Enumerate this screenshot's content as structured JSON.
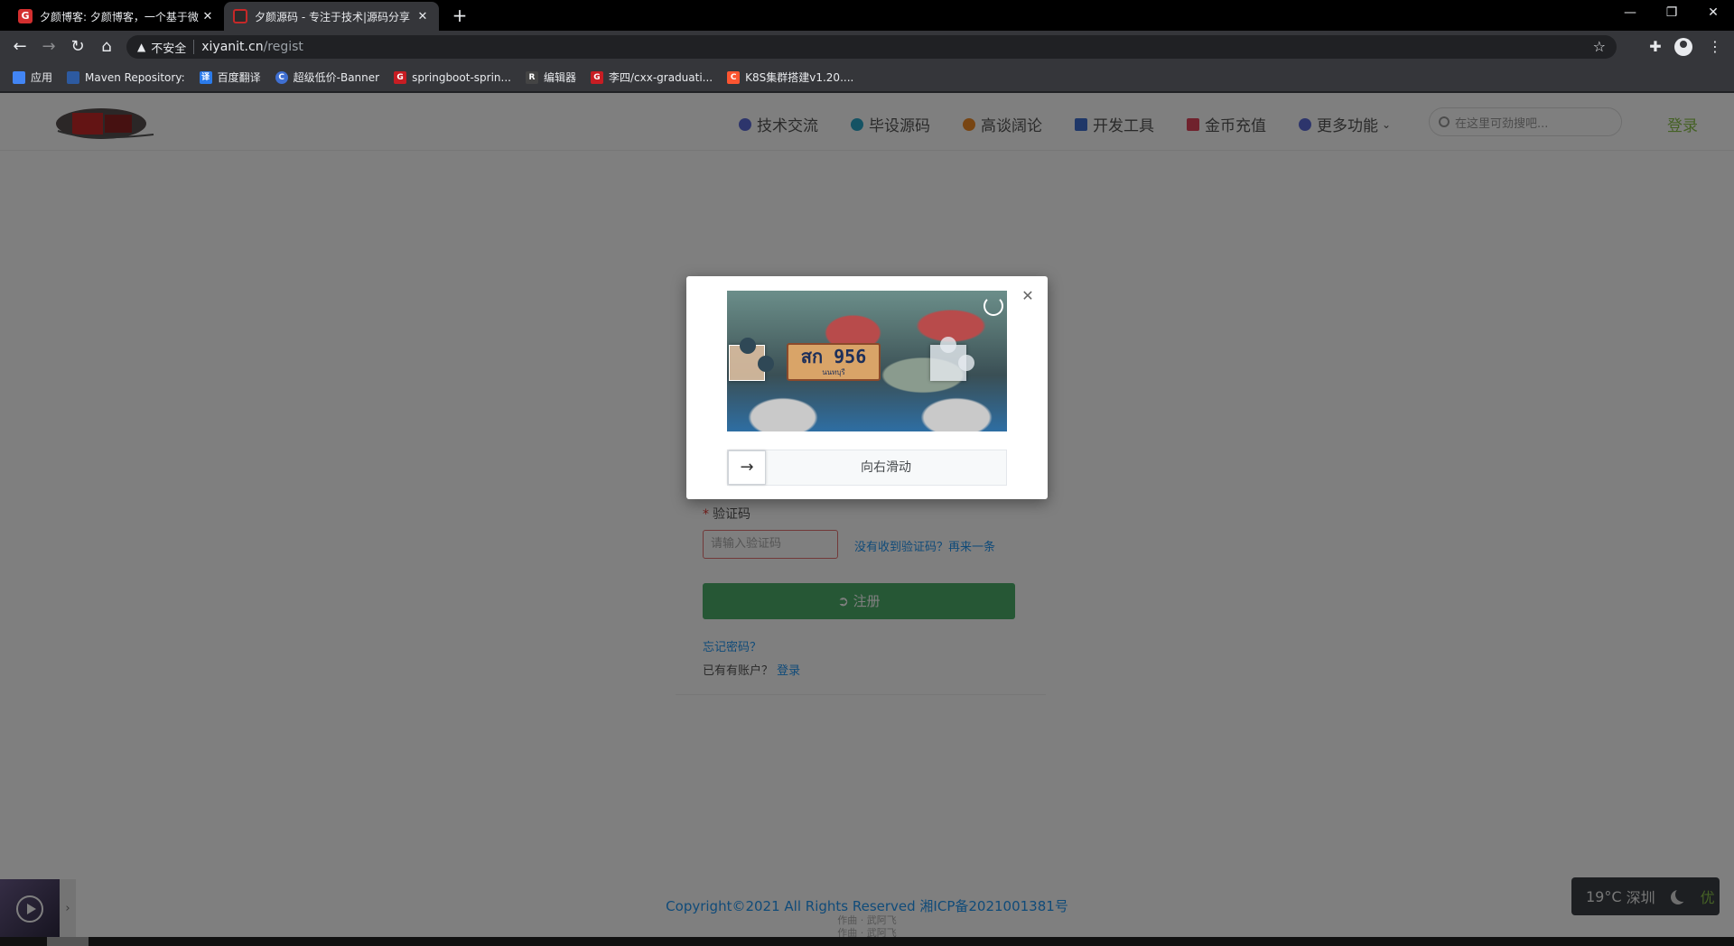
{
  "browser": {
    "tabs": [
      {
        "title": "夕颜博客: 夕颜博客，一个基于微",
        "close": "✕"
      },
      {
        "title": "夕颜源码 - 专注于技术|源码分享",
        "close": "✕"
      }
    ],
    "new_tab": "+",
    "window_controls": {
      "minimize": "—",
      "restore": "❐",
      "close": "✕"
    },
    "nav": {
      "back": "←",
      "forward": "→",
      "reload": "↻",
      "home": "⌂"
    },
    "address": {
      "security_label": "不安全",
      "host": "xiyanit.cn",
      "path": "/regist"
    },
    "bookmarks": [
      {
        "label": "应用",
        "icon": "apps-grid-icon",
        "color": "#4285f4"
      },
      {
        "label": "Maven Repository:",
        "icon": "maven-icon",
        "color": "#2d5aa0"
      },
      {
        "label": "百度翻译",
        "icon": "baidu-translate-icon",
        "color": "#2b7bea"
      },
      {
        "label": "超级低价-Banner",
        "icon": "c-logo-icon",
        "color": "#3f6fd1"
      },
      {
        "label": "springboot-sprin...",
        "icon": "gitee-icon",
        "color": "#c71d23"
      },
      {
        "label": "编辑器",
        "icon": "editor-icon",
        "color": "#444444"
      },
      {
        "label": "李四/cxx-graduati...",
        "icon": "gitee-icon",
        "color": "#c71d23"
      },
      {
        "label": "K8S集群搭建v1.20....",
        "icon": "csdn-icon",
        "color": "#fc5531"
      }
    ]
  },
  "site": {
    "nav": [
      {
        "label": "技术交流",
        "icon": "rocket-icon",
        "color": "#5b6bd8"
      },
      {
        "label": "毕设源码",
        "icon": "nodes-icon",
        "color": "#2aa6c9"
      },
      {
        "label": "高谈阔论",
        "icon": "cloud-icon",
        "color": "#f08a24"
      },
      {
        "label": "开发工具",
        "icon": "briefcase-icon",
        "color": "#3f6fd1"
      },
      {
        "label": "金币充值",
        "icon": "card-icon",
        "color": "#e0445a"
      },
      {
        "label": "更多功能",
        "icon": "more-icon",
        "color": "#5b6bd8"
      }
    ],
    "search_placeholder": "在这里可劲搜吧...",
    "login": "登录"
  },
  "form": {
    "code_label": "验证码",
    "code_placeholder": "请输入验证码",
    "resend": "没有收到验证码？再来一条",
    "submit": "注册",
    "forgot": "忘记密码？",
    "have_account": "已有有账户？",
    "login_link": "登录"
  },
  "captcha": {
    "plate_number": "สก 956",
    "plate_sub": "นนทบุรี",
    "slide_hint": "向右滑动",
    "handle_arrow": "→",
    "close": "✕"
  },
  "footer": {
    "copyright": "Copyright©2021 All Rights Reserved 湘ICP备2021001381号",
    "sub1": "作曲 · 武阿飞",
    "sub2": "作曲 · 武阿飞"
  },
  "weather": {
    "temp": "19°C",
    "city": "深圳",
    "aqi": "优"
  }
}
